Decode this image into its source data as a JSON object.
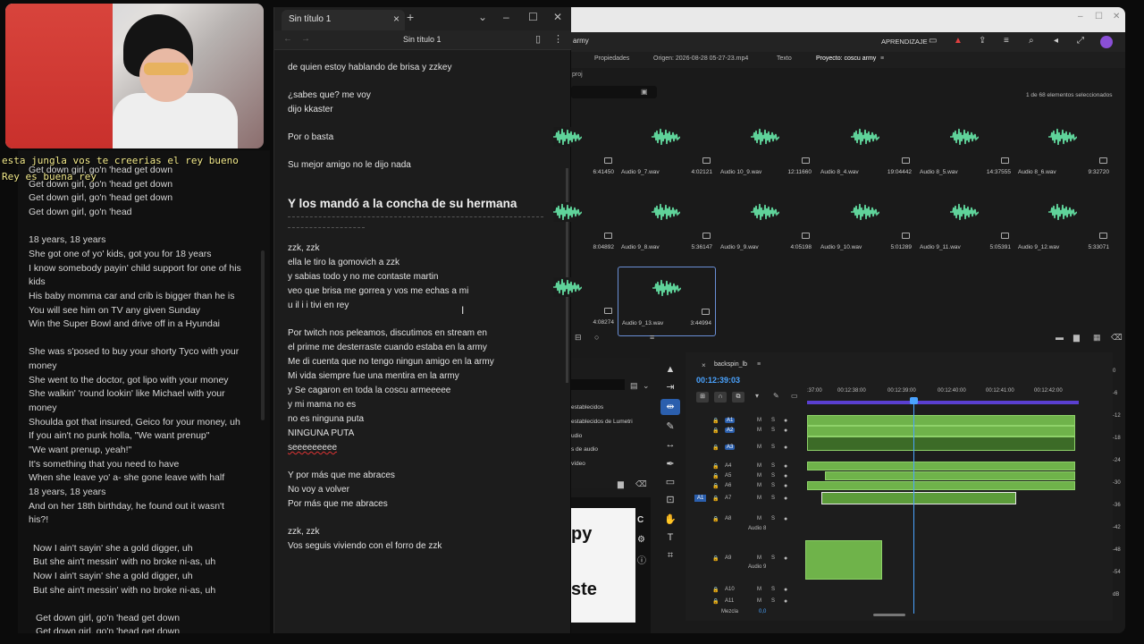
{
  "chat": {
    "line1": "esta jungla vos te creerias el rey bueno",
    "line2": "Rey es buena rey"
  },
  "lyrics": [
    "Get down girl, go'n 'head get down",
    "Get down girl, go'n 'head get down",
    "Get down girl, go'n 'head get down",
    "Get down girl, go'n 'head",
    "",
    "18 years, 18 years",
    "She got one of yo' kids, got you for 18 years",
    "I know somebody payin' child support for one of his",
    "kids",
    "His baby momma car and crib is bigger than he is",
    "You will see him on TV any given Sunday",
    "Win the Super Bowl and drive off in a Hyundai",
    "",
    "She was s'posed to buy your shorty Tyco with your",
    "money",
    "She went to the doctor, got lipo with your money",
    "She walkin' 'round lookin' like Michael with your",
    "money",
    "Shoulda got that insured, Geico for your money, uh",
    "If you ain't no punk holla, \"We want prenup\"",
    "\"We want prenup, yeah!\"",
    "It's something that you need to have",
    "When she leave yo' a- she gone leave with half",
    "18 years, 18 years",
    "And on her 18th birthday, he found out it wasn't",
    "his?!",
    "",
    "Now I ain't sayin' she a gold digger, uh",
    "But she ain't messin' with no broke ni-as, uh",
    "Now I ain't sayin' she a gold digger, uh",
    "But she ain't messin' with no broke ni-as, uh",
    "",
    "Get down girl, go'n 'head get down",
    "Get down girl, go'n 'head get down"
  ],
  "notepad": {
    "tab_title": "Sin título 1",
    "doc_title": "Sin título 1",
    "lines": {
      "l1": "de quien estoy hablando de brisa y zzkey",
      "l2": "¿sabes que? me voy",
      "l3": "dijo kkaster",
      "l4": "Por   o basta",
      "l5": "Su mejor amigo no le dijo nada",
      "heading": "Y los mandó a la concha de su hermana",
      "l6": "zzk, zzk",
      "l7": "ella le tiro la gomovich a zzk",
      "l8": "y sabias todo y no me contaste martin",
      "l9": "veo que brisa me gorrea y vos me echas a mi",
      "l10": "u il i i tivi en rey",
      "l11": "Por twitch nos peleamos, discutimos en stream en",
      "l12": "el prime me desterraste cuando estaba en la army",
      "l13": "Me di cuenta que no tengo ningun amigo en la army",
      "l14": "Mi vida siempre fue una mentira en la army",
      "l15": "y Se cagaron en toda la coscu armeeeee",
      "l16": "y mi mama no es",
      "l17": "no es ninguna puta",
      "l18": "NINGUNA PUTA",
      "l19": "seeeeeeeee",
      "l20": "Y por más que me abraces",
      "l21": "No voy a volver",
      "l22": "Por más que me abraces",
      "l23": "zzk, zzk",
      "l24": "Vos seguis viviendo con el forro de zzk"
    }
  },
  "premiere": {
    "menubar": {
      "project_short": "army",
      "learn": "APRENDIZAJE"
    },
    "tabs": {
      "properties": "Propiedades",
      "origin": "Origen: 2026-08-28 05-27-23.mp4",
      "text": "Texto",
      "project": "Proyecto: coscu army"
    },
    "proj_file": "proj",
    "selection_count": "1 de 68 elementos seleccionados",
    "clips": [
      {
        "name": "",
        "dur": "6:41450"
      },
      {
        "name": "Audio 9_7.wav",
        "dur": "4:02121"
      },
      {
        "name": "Audio 10_9.wav",
        "dur": "12:11660"
      },
      {
        "name": "Audio 8_4.wav",
        "dur": "19:04442"
      },
      {
        "name": "Audio 8_5.wav",
        "dur": "14:37555"
      },
      {
        "name": "Audio 8_6.wav",
        "dur": "9:32720"
      },
      {
        "name": "",
        "dur": "8:04892"
      },
      {
        "name": "Audio 9_8.wav",
        "dur": "5:36147"
      },
      {
        "name": "Audio 9_9.wav",
        "dur": "4:05198"
      },
      {
        "name": "Audio 9_10.wav",
        "dur": "5:01289"
      },
      {
        "name": "Audio 9_11.wav",
        "dur": "5:05391"
      },
      {
        "name": "Audio 9_12.wav",
        "dur": "5:33071"
      },
      {
        "name": "",
        "dur": "4:08274"
      },
      {
        "name": "Audio 9_13.wav",
        "dur": "3:44994"
      }
    ],
    "effects": {
      "items": [
        "establecidos",
        "establecidos de Lumetri",
        "udio",
        "s de audio",
        "vídeo"
      ]
    },
    "program": {
      "word1": "py",
      "word2": "ste",
      "side": "C"
    },
    "timeline": {
      "sequence": "backspin_lb",
      "timecode": "00:12:39:03",
      "ruler": [
        ":37:00",
        "00:12:38:00",
        "00:12:39:00",
        "00:12:40:00",
        "00:12:41:00",
        "00:12:42:00"
      ],
      "tracks": [
        "A1",
        "A2",
        "A3",
        "A4",
        "A5",
        "A6",
        "A7",
        "A8",
        "A9",
        "A10",
        "A11"
      ],
      "audio8": "Audio 8",
      "audio9": "Audio 9",
      "mix_label": "Mezcla",
      "mix_value": "0,0"
    },
    "meters": [
      "0",
      "-6",
      "-12",
      "-18",
      "-24",
      "-30",
      "-36",
      "-42",
      "-48",
      "-54",
      "dB"
    ],
    "accent": "#4aa3ff",
    "clip_green": "#6fb34a"
  }
}
